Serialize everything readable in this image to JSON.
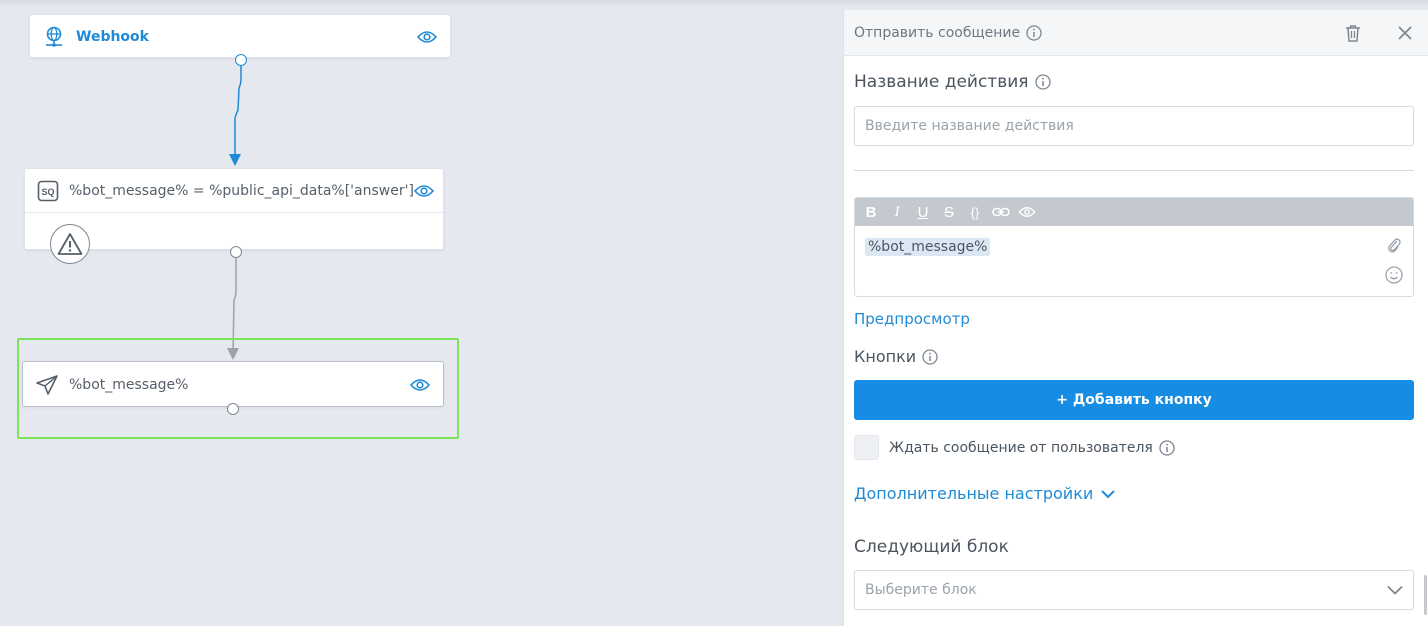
{
  "canvas": {
    "nodes": {
      "webhook": {
        "title": "Webhook",
        "icon": "globe-network-icon"
      },
      "assign": {
        "title": "%bot_message% = %public_api_data%['answer']",
        "icon": "sql-icon",
        "badge": "SQ"
      },
      "send": {
        "title": "%bot_message%",
        "icon": "paper-plane-icon"
      }
    },
    "colors": {
      "accent": "#1f8ad6",
      "selection": "#7be35a"
    }
  },
  "panel": {
    "header_title": "Отправить сообщение",
    "action_name": {
      "label": "Название действия",
      "placeholder": "Введите название действия"
    },
    "editor": {
      "content": "%bot_message%",
      "toolbar": [
        "bold-icon",
        "italic-icon",
        "underline-icon",
        "strikethrough-icon",
        "braces-icon",
        "link-icon",
        "eye-icon"
      ]
    },
    "preview_link": "Предпросмотр",
    "buttons_label": "Кнопки",
    "add_button": "+ Добавить кнопку",
    "wait_checkbox_label": "Ждать сообщение от пользователя",
    "advanced_link": "Дополнительные настройки",
    "next_block": {
      "label": "Следующий блок",
      "placeholder": "Выберите блок"
    }
  }
}
